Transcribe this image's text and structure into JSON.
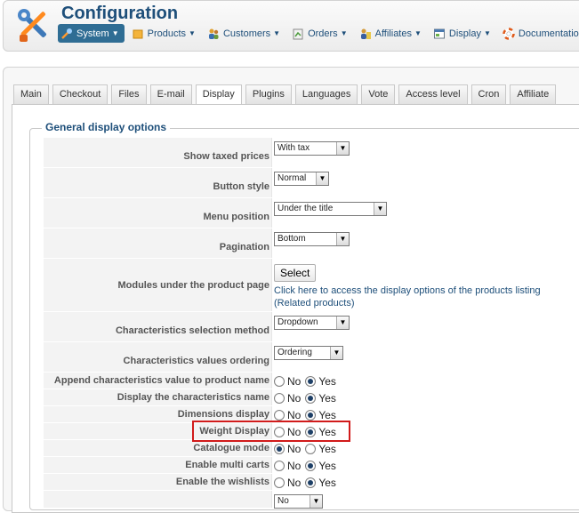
{
  "header": {
    "title": "Configuration",
    "logo_icon": "wrench-screwdriver-icon"
  },
  "menu": [
    {
      "label": "System",
      "icon": "tools-icon",
      "active": true
    },
    {
      "label": "Products",
      "icon": "products-icon"
    },
    {
      "label": "Customers",
      "icon": "customers-icon"
    },
    {
      "label": "Orders",
      "icon": "orders-icon"
    },
    {
      "label": "Affiliates",
      "icon": "affiliates-icon"
    },
    {
      "label": "Display",
      "icon": "display-icon"
    },
    {
      "label": "Documentation",
      "icon": "lifebuoy-icon"
    }
  ],
  "tabs": [
    "Main",
    "Checkout",
    "Files",
    "E-mail",
    "Display",
    "Plugins",
    "Languages",
    "Vote",
    "Access level",
    "Cron",
    "Affiliate"
  ],
  "active_tab": "Display",
  "section": {
    "legend": "General display options"
  },
  "fields": {
    "taxed": {
      "label": "Show taxed prices",
      "value": "With tax"
    },
    "button_style": {
      "label": "Button style",
      "value": "Normal"
    },
    "menu_position": {
      "label": "Menu position",
      "value": "Under the title"
    },
    "pagination": {
      "label": "Pagination",
      "value": "Bottom"
    },
    "modules": {
      "label": "Modules under the product page",
      "button": "Select",
      "link_text": "Click here to access the display options of the products listing",
      "link_sub": "(Related products)"
    },
    "char_method": {
      "label": "Characteristics selection method",
      "value": "Dropdown"
    },
    "char_order": {
      "label": "Characteristics values ordering",
      "value": "Ordering"
    },
    "append_char": {
      "label": "Append characteristics value to product name",
      "no": "No",
      "yes": "Yes",
      "selected": "Yes"
    },
    "display_char": {
      "label": "Display the characteristics name",
      "no": "No",
      "yes": "Yes",
      "selected": "Yes"
    },
    "dimensions": {
      "label": "Dimensions display",
      "no": "No",
      "yes": "Yes",
      "selected": "Yes"
    },
    "weight": {
      "label": "Weight Display",
      "no": "No",
      "yes": "Yes",
      "selected": "Yes"
    },
    "catalogue": {
      "label": "Catalogue mode",
      "no": "No",
      "yes": "Yes",
      "selected": "No"
    },
    "multicarts": {
      "label": "Enable multi carts",
      "no": "No",
      "yes": "Yes",
      "selected": "Yes"
    },
    "wishlists": {
      "label": "Enable the wishlists",
      "no": "No",
      "yes": "Yes",
      "selected": "Yes"
    },
    "next_value": "No"
  },
  "colors": {
    "accent": "#1e4f7a",
    "highlight": "#d11b1b",
    "active_menu": "#2f6d94"
  }
}
